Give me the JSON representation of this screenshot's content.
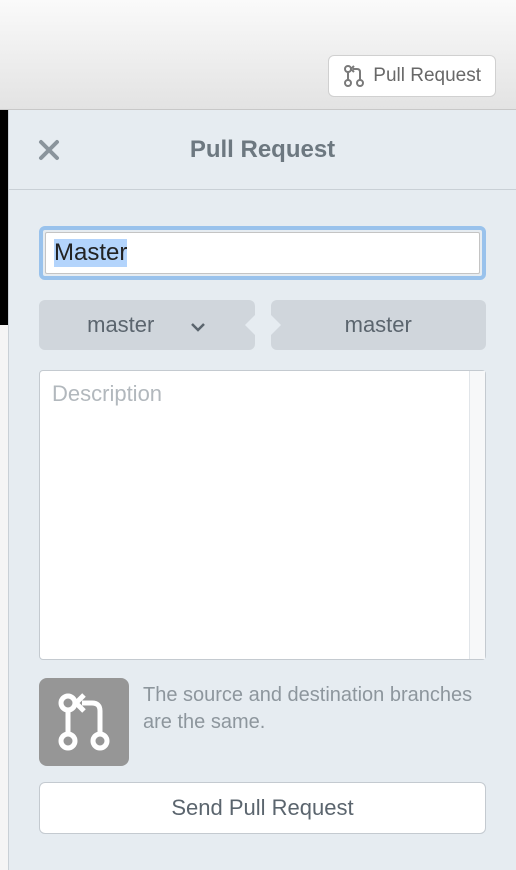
{
  "toolbar": {
    "pull_request_button": "Pull Request"
  },
  "panel": {
    "title": "Pull Request",
    "title_input_value": "Master",
    "source_branch": "master",
    "target_branch": "master",
    "description_placeholder": "Description",
    "description_value": "",
    "warning_text": "The source and destination branches are the same.",
    "send_button": "Send Pull Request"
  },
  "icons": {
    "pull_request": "pull-request-icon",
    "close": "close-icon",
    "chevron_down": "chevron-down-icon"
  }
}
